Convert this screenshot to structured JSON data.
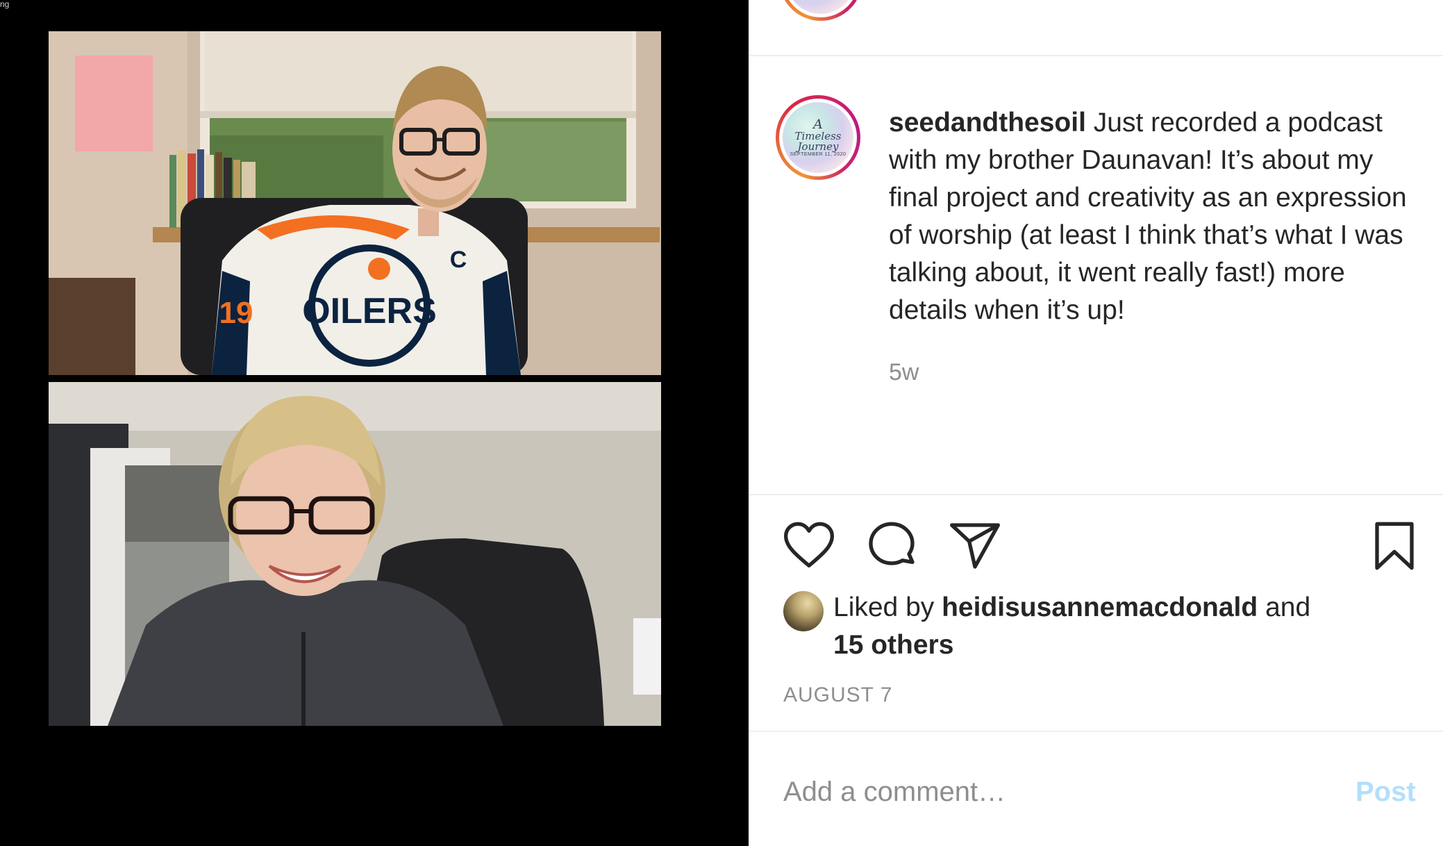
{
  "media": {
    "corner_text": "ng",
    "tiles": [
      {
        "jersey_text": "OILERS",
        "jersey_number": "19",
        "jersey_letter": "C"
      },
      {}
    ]
  },
  "profile": {
    "logo_line1": "A",
    "logo_line2": "Timeless",
    "logo_line3": "Journey",
    "logo_date": "SEPTEMBER 11, 2020"
  },
  "post": {
    "username": "seedandthesoil",
    "caption": "Just recorded a podcast with my brother Daunavan! It’s about my final project and creativity as an expression of worship (at least I think that’s what I was talking about, it went really fast!) more details when it’s up!",
    "time_ago": "5w"
  },
  "actions": {
    "icons": [
      "heart-icon",
      "comment-icon",
      "share-icon",
      "bookmark-icon"
    ]
  },
  "likes": {
    "prefix": "Liked by",
    "liker": "heidisusannemacdonald",
    "connector": "and",
    "others": "15 others"
  },
  "date": "AUGUST 7",
  "comment": {
    "placeholder": "Add a comment…",
    "post_label": "Post"
  },
  "colors": {
    "text": "#262626",
    "muted": "#8e8e8e",
    "post_button_disabled": "#b2dffc",
    "divider": "#efefef"
  }
}
